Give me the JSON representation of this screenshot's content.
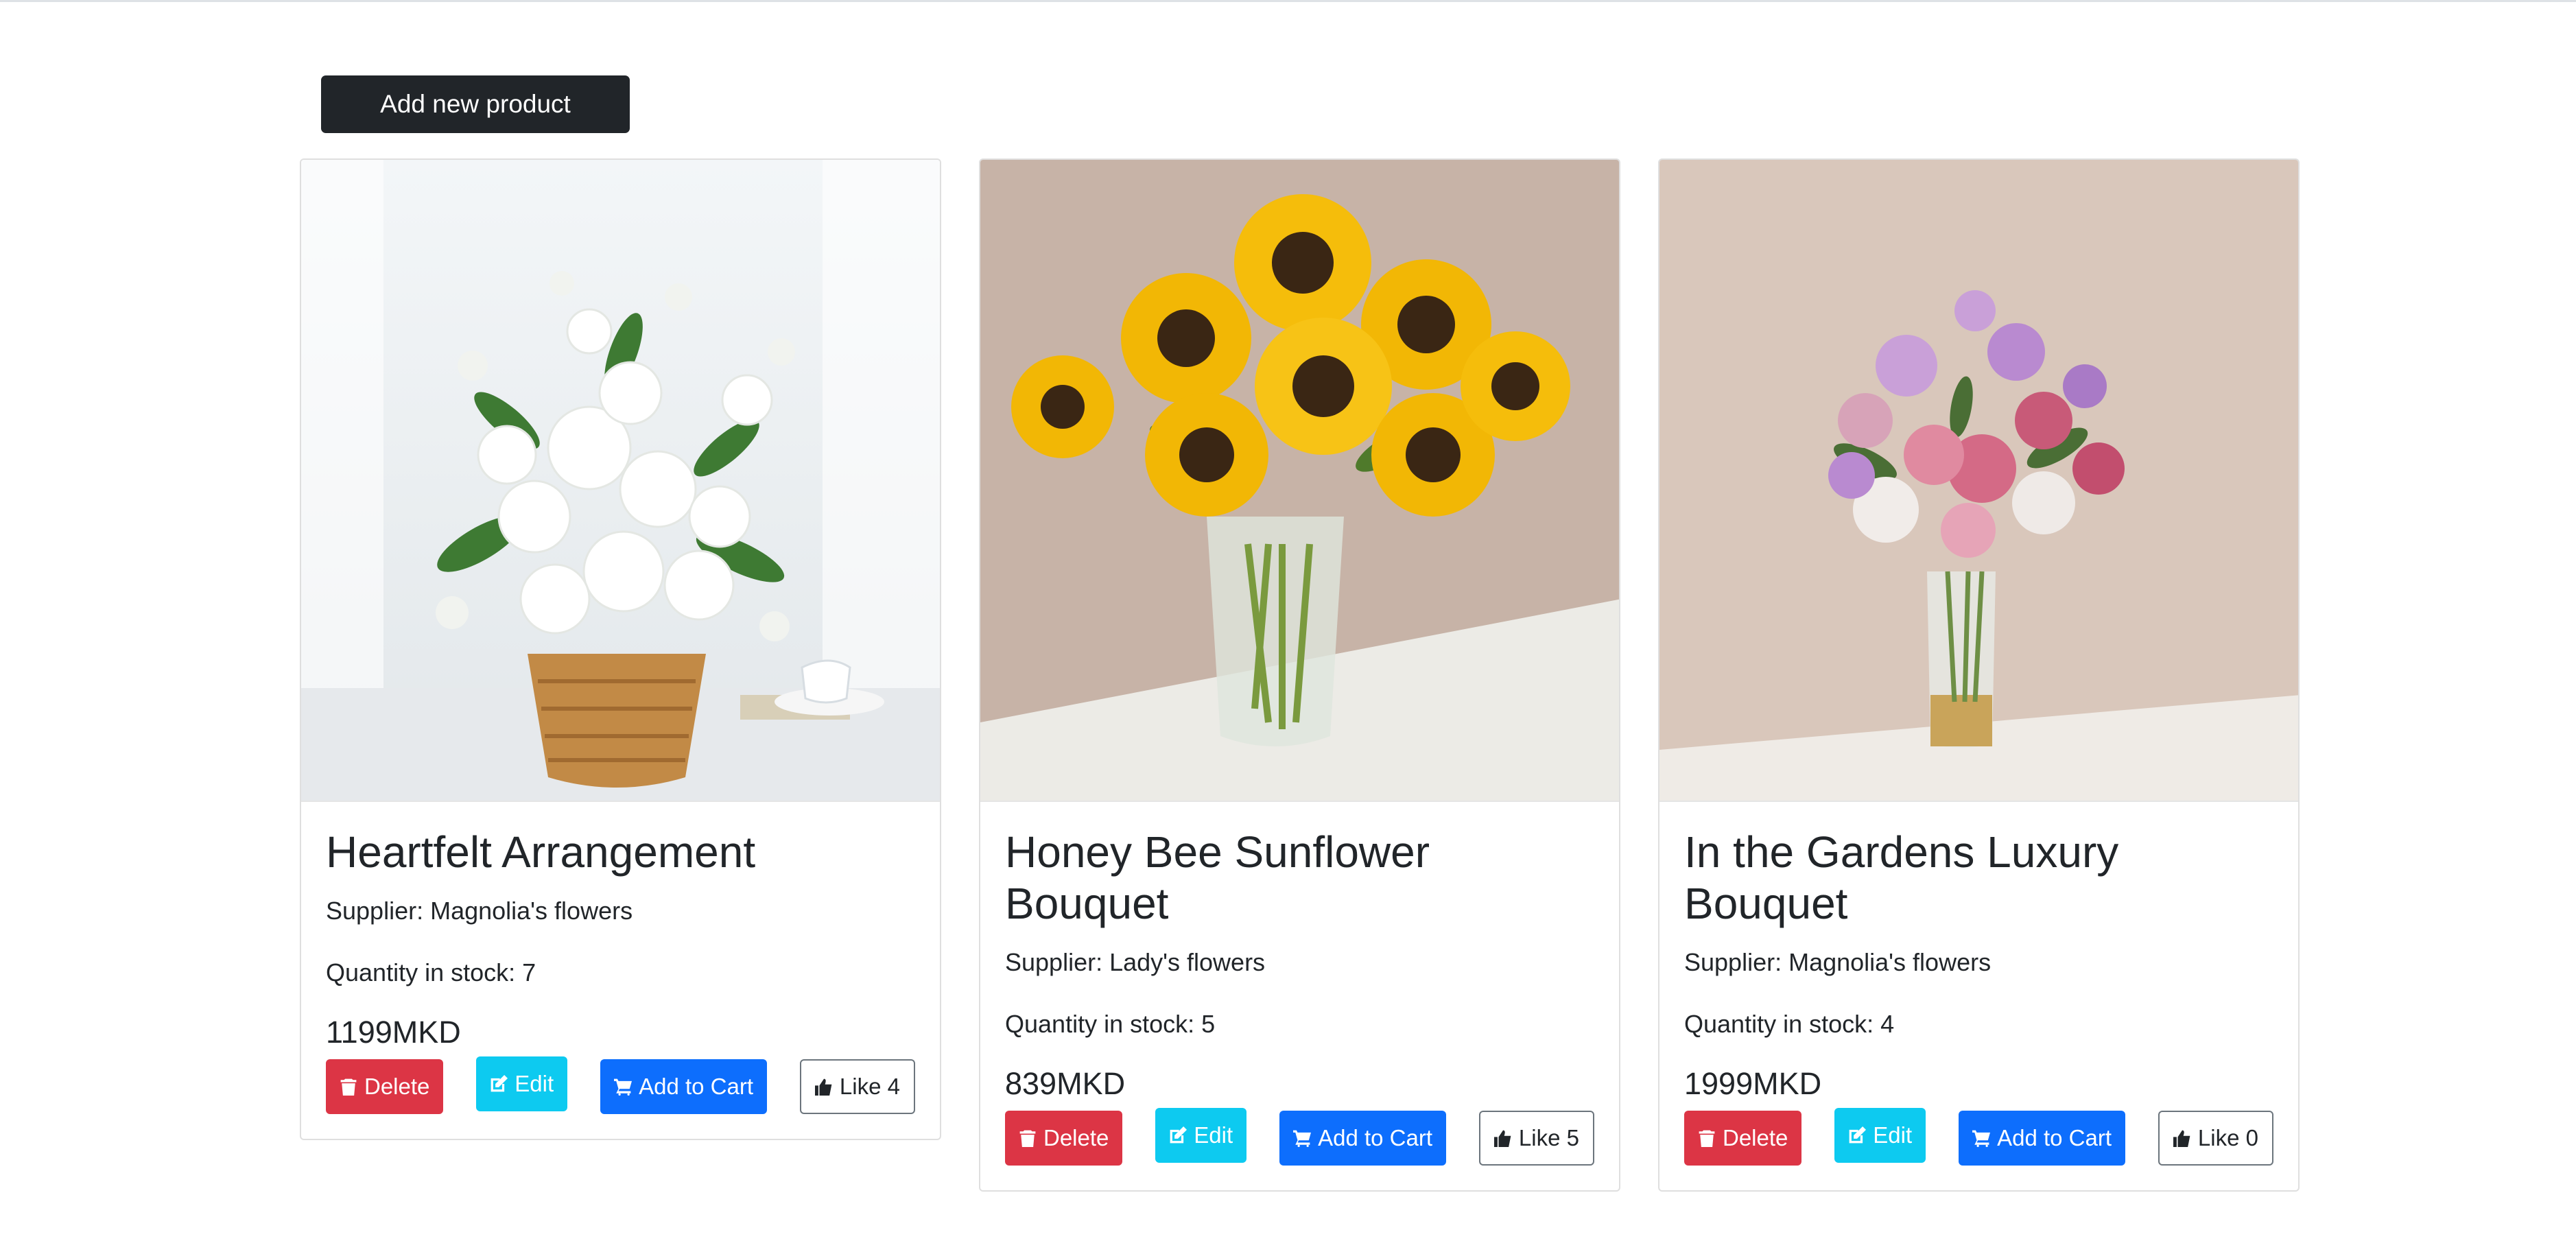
{
  "toolbar": {
    "add_label": "Add new product"
  },
  "products": [
    {
      "title": "Heartfelt Arrangement",
      "supplier": "Supplier: Magnolia's flowers",
      "quantity": "Quantity in stock: 7",
      "price": "1199MKD",
      "delete_label": "Delete",
      "edit_label": "Edit",
      "cart_label": "Add to Cart",
      "like_label": "Like 4"
    },
    {
      "title": "Honey Bee Sunflower Bouquet",
      "supplier": "Supplier: Lady's flowers",
      "quantity": "Quantity in stock: 5",
      "price": "839MKD",
      "delete_label": "Delete",
      "edit_label": "Edit",
      "cart_label": "Add to Cart",
      "like_label": "Like 5"
    },
    {
      "title": "In the Gardens Luxury Bouquet",
      "supplier": "Supplier: Magnolia's flowers",
      "quantity": "Quantity in stock: 4",
      "price": "1999MKD",
      "delete_label": "Delete",
      "edit_label": "Edit",
      "cart_label": "Add to Cart",
      "like_label": "Like 0"
    }
  ],
  "icons": {
    "delete": "trash-icon",
    "edit": "edit-icon",
    "cart": "cart-icon",
    "like": "thumbs-up-icon"
  },
  "colors": {
    "primary": "#0d6efd",
    "danger": "#dc3545",
    "info": "#0dcaf0",
    "dark": "#212529"
  }
}
